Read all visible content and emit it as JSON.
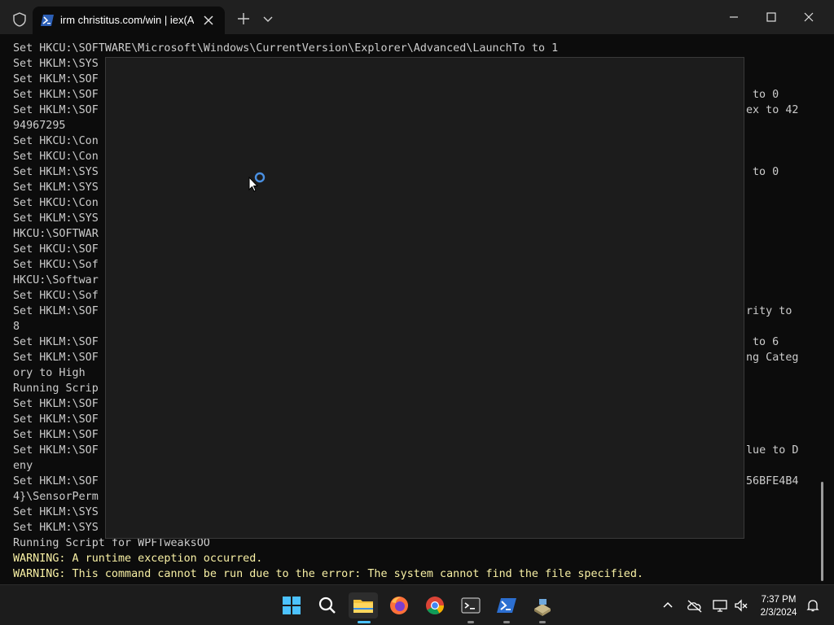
{
  "window": {
    "tab_title": "irm christitus.com/win | iex(Ad",
    "tab_icon": "powershell-icon",
    "buttons": [
      "minimize",
      "maximize",
      "close"
    ]
  },
  "terminal": {
    "colors": {
      "text": "#cccccc",
      "warning": "#f9f1a5",
      "background": "#0c0c0c"
    },
    "lines": [
      "Set HKCU:\\SOFTWARE\\Microsoft\\Windows\\CurrentVersion\\Explorer\\Advanced\\LaunchTo to 1",
      "Set HKLM:\\SYS",
      "Set HKLM:\\SOF",
      "Set HKLM:\\SOF",
      "Set HKLM:\\SOF",
      "94967295",
      "Set HKCU:\\Con",
      "Set HKCU:\\Con",
      "Set HKLM:\\SYS",
      "Set HKLM:\\SYS",
      "Set HKCU:\\Con",
      "Set HKLM:\\SYS",
      "HKCU:\\SOFTWAR",
      "Set HKCU:\\SOF",
      "Set HKCU:\\Sof",
      "HKCU:\\Softwar",
      "Set HKCU:\\Sof",
      "Set HKLM:\\SOF",
      "8",
      "Set HKLM:\\SOF",
      "Set HKLM:\\SOF",
      "ory to High",
      "Running Scrip",
      "Set HKLM:\\SOF",
      "Set HKLM:\\SOF",
      "Set HKLM:\\SOF",
      "Set HKLM:\\SOF",
      "eny",
      "Set HKLM:\\SOF",
      "4}\\SensorPerm",
      "Set HKLM:\\SYS",
      "Set HKLM:\\SYS",
      "Running Script for WPFTweaksOO"
    ],
    "right_fragments": {
      "r3": "to 0",
      "r4": "ex to 42",
      "r8": "to 0",
      "r17": "rity to",
      "r19": "to 6",
      "r20": "ng Categ",
      "r26": "lue to D",
      "r28": "56BFE4B4"
    },
    "warnings": [
      "WARNING: A runtime exception occurred.",
      "WARNING: This command cannot be run due to the error: The system cannot find the file specified."
    ]
  },
  "taskbar": {
    "apps": [
      "windows-start",
      "search",
      "file-explorer",
      "firefox",
      "chrome",
      "terminal",
      "powershell",
      "app"
    ],
    "time": "7:37 PM",
    "date": "2/3/2024"
  }
}
